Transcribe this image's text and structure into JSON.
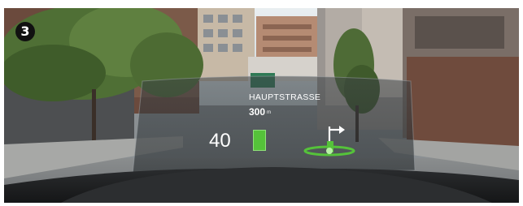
{
  "badge": {
    "number": "3"
  },
  "hud": {
    "street_name": "HAUPTSTRASSE",
    "distance_value": "300",
    "distance_unit": "m",
    "speed": "40",
    "accent_color": "#55c23a",
    "arrow_icon": "turn-right-arrow-icon"
  }
}
